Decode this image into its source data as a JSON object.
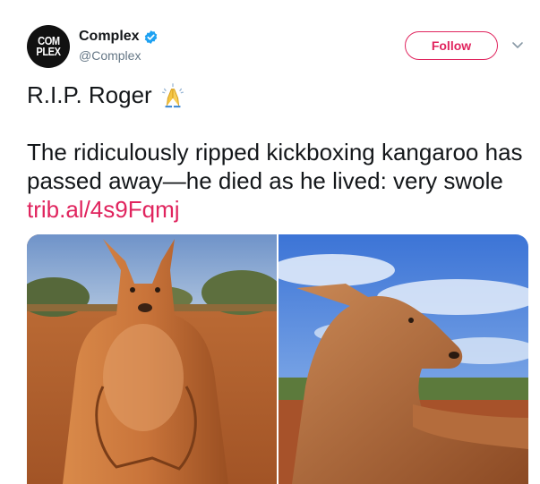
{
  "account": {
    "avatar_text_top": "COM",
    "avatar_text_bottom": "PLEX",
    "display_name": "Complex",
    "handle": "@Complex",
    "verified": true
  },
  "follow_button": {
    "label": "Follow"
  },
  "menu": {
    "icon": "chevron-down-icon"
  },
  "tweet": {
    "line1": "R.I.P. Roger",
    "emoji_icon": "folded-hands-icon",
    "body": "The ridiculously ripped kickboxing kangaroo has passed away—he died as he lived: very swole",
    "link": "trib.al/4s9Fqmj"
  },
  "media": {
    "photos": [
      {
        "subject": "kangaroo standing in red outback"
      },
      {
        "subject": "kangaroo lying under blue cloudy sky"
      }
    ]
  },
  "colors": {
    "accent": "#e0245e",
    "verified": "#1da1f2",
    "text": "#14171a",
    "muted": "#657786"
  }
}
